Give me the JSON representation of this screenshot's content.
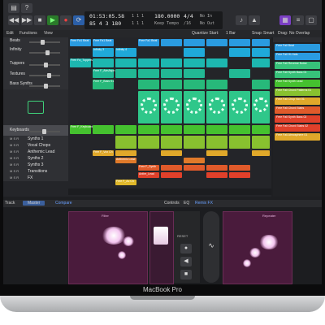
{
  "window": {
    "brand": "MacBook Pro"
  },
  "lcd": {
    "time": "01:53:05.58",
    "bars": "85  4  3  180",
    "tempo": "180.0000",
    "tempo_mode": "Keep Tempo",
    "signature": "4/4",
    "division": "/16",
    "in_status": "No In",
    "out_status": "No Out",
    "beat_small": "1  1  1",
    "beat_small2": "1  1  1"
  },
  "menu": {
    "edit": "Edit",
    "functions": "Functions",
    "view": "View",
    "quantize": "Quantize Start:",
    "quantize_value": "1 Bar",
    "snap": "Snap:",
    "snap_value": "Smart",
    "drag": "Drag:",
    "drag_value": "No Overlap"
  },
  "tracks": [
    {
      "name": "Beats"
    },
    {
      "name": "Infinity"
    },
    {
      "name": "Tuppers"
    },
    {
      "name": "Textures"
    },
    {
      "name": "Bass Synths"
    },
    {
      "name": "Keyboards"
    },
    {
      "name": "Synths 1"
    },
    {
      "name": "Vocal Chops"
    },
    {
      "name": "Anthemic Lead"
    },
    {
      "name": "Synths 2"
    },
    {
      "name": "Synths 3"
    },
    {
      "name": "Transitions"
    },
    {
      "name": "FX"
    }
  ],
  "cells": {
    "beat1": "Free Fa1 Beat",
    "beat2": "Free Fa1 Beat",
    "beat3": "Free Fa1 Beat",
    "inf1": "Infinity 3",
    "inf2": "Infinity 4",
    "tup1": "Free Fa_Tuppers",
    "tex1": "Free F_AtmAsph",
    "bass1": "Free F_Bass S1",
    "key1": "Free F_Keyboard",
    "voc1": "Free F_Vox Ch",
    "ant1": "Anthemic Lead",
    "syn1": "Free F_Synth",
    "syn2": "Anthe_Lead",
    "fx1": "Free F_Ac Ch"
  },
  "right_regions": [
    {
      "label": "Free Fall Beat",
      "color": "#2a9be0"
    },
    {
      "label": "Free Fall Hi-Hats",
      "color": "#2a9be0"
    },
    {
      "label": "Free Fall Reverse Noise",
      "color": "#37c27a"
    },
    {
      "label": "Free Fall Synth Bass 01",
      "color": "#37c27a"
    },
    {
      "label": "Free Fall Synth Lead",
      "color": "#45c12f"
    },
    {
      "label": "Free Fall Chord Patterns 01",
      "color": "#88c12f"
    },
    {
      "label": "Free Fall Chop Vox 01",
      "color": "#e0a82a"
    },
    {
      "label": "Free Fall Chord Stabs",
      "color": "#e05a2a"
    },
    {
      "label": "Free Fall Synth Bass 02",
      "color": "#e0402a"
    },
    {
      "label": "Free Fall Chord Stabs 02",
      "color": "#e0402a"
    },
    {
      "label": "Free Fall Atmosphere 01",
      "color": "#e0a82a"
    }
  ],
  "bottom": {
    "track": "Track",
    "master": "Master",
    "compare": "Compare",
    "controls": "Controls",
    "eq": "EQ",
    "remix_fx": "Remix FX",
    "left_pad": "Filter",
    "right_pad": "Repeater",
    "reset": "RESET"
  }
}
